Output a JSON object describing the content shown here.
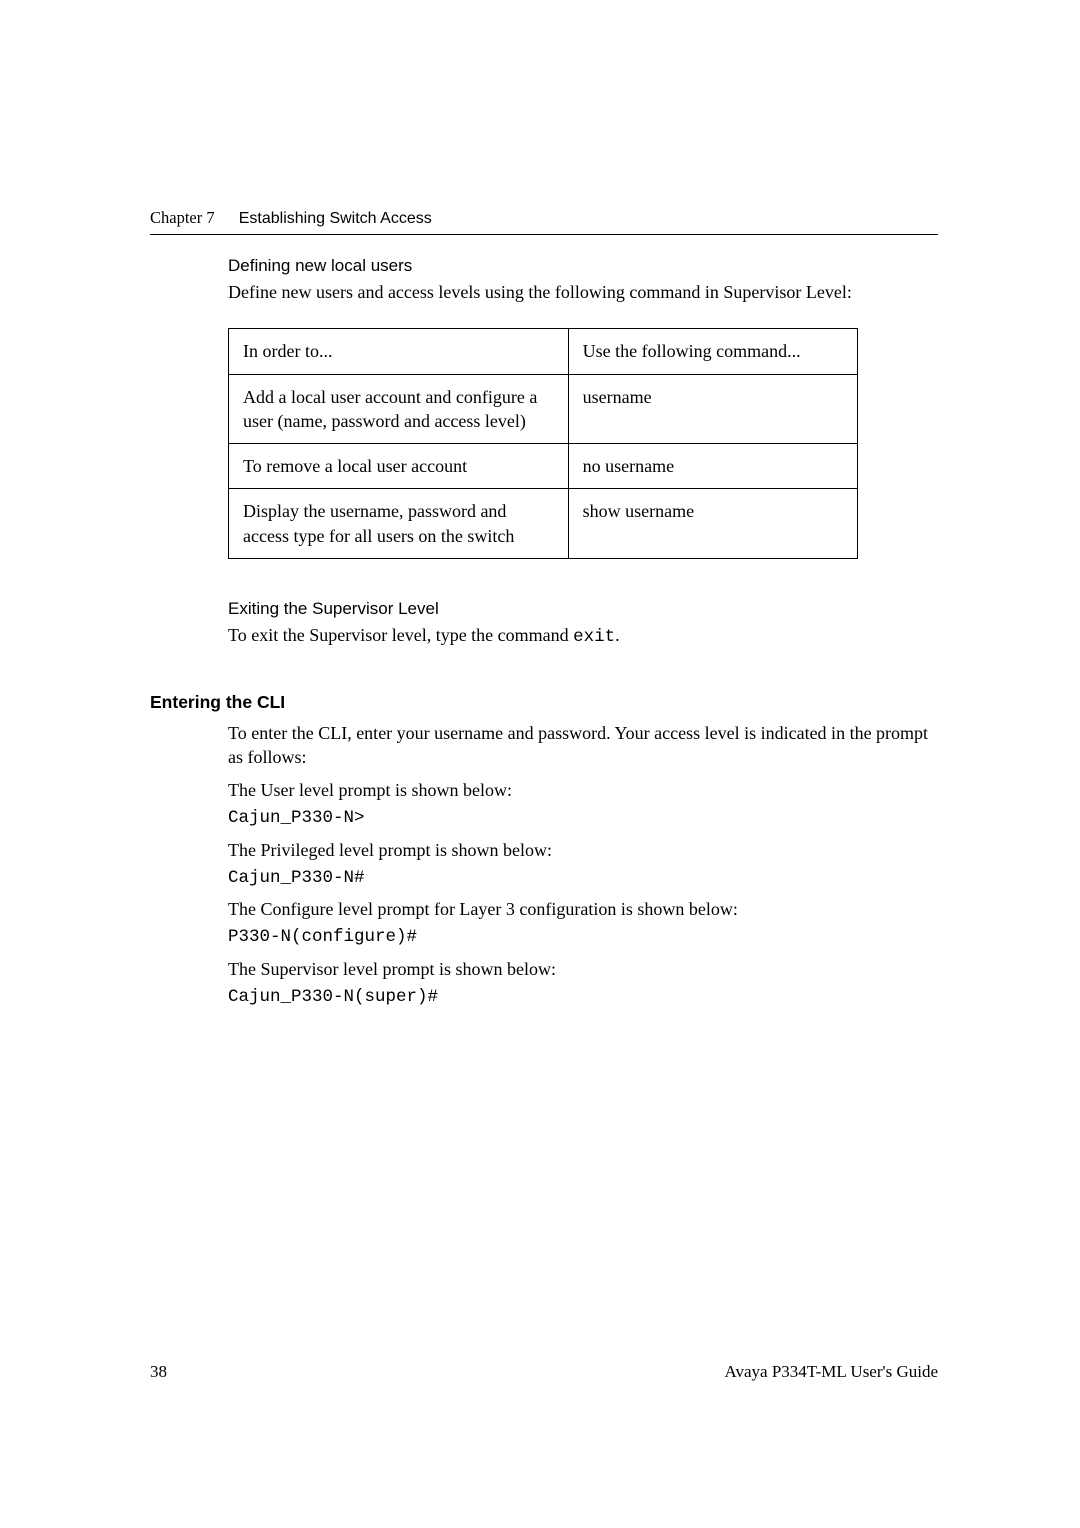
{
  "header": {
    "chapter_label": "Chapter 7",
    "chapter_title": "Establishing Switch Access"
  },
  "section1": {
    "heading": "Defining new local users",
    "intro": "Define new users and access levels using the following command in Supervisor Level:"
  },
  "table": {
    "headers": [
      "In order to...",
      "Use the following command..."
    ],
    "rows": [
      {
        "action": "Add a local user account and configure a user (name, password and access level)",
        "command": "username"
      },
      {
        "action": "To remove a local user account",
        "command": "no username"
      },
      {
        "action": "Display the username, password and access type for all users on the switch",
        "command": "show username"
      }
    ]
  },
  "section2": {
    "heading": "Exiting the Supervisor Level",
    "text_prefix": "To exit the Supervisor level, type the command ",
    "command": "exit",
    "text_suffix": "."
  },
  "section3": {
    "heading": "Entering the CLI",
    "intro": "To enter the CLI, enter your username and password. Your access level is indicated in the prompt as follows:",
    "prompts": [
      {
        "label": "The User level prompt is shown below:",
        "prompt": "Cajun_P330-N>"
      },
      {
        "label": "The Privileged level prompt is shown below:",
        "prompt": "Cajun_P330-N#"
      },
      {
        "label": "The Configure level prompt for Layer 3 configuration is shown below:",
        "prompt": "P330-N(configure)#"
      },
      {
        "label": "The Supervisor level prompt is shown below:",
        "prompt": "Cajun_P330-N(super)#"
      }
    ]
  },
  "footer": {
    "page_number": "38",
    "guide_name": "Avaya P334T-ML User's Guide"
  }
}
